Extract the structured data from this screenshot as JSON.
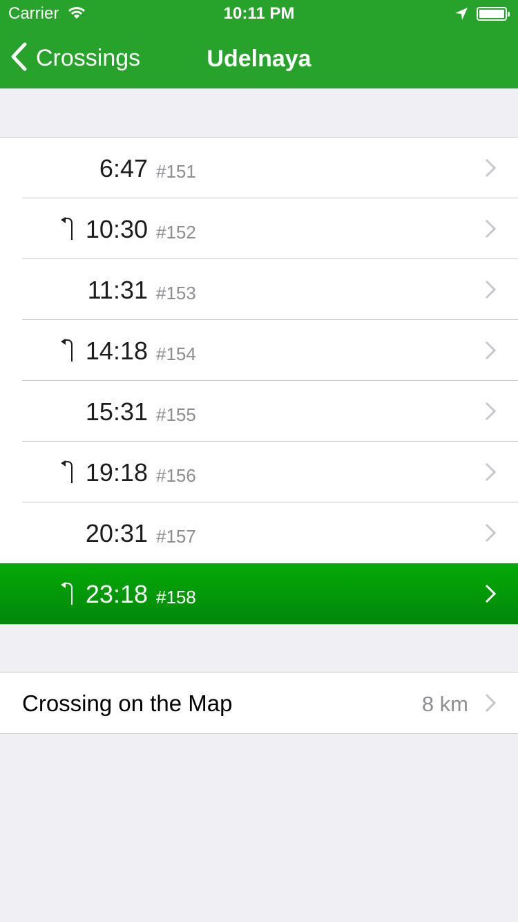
{
  "status_bar": {
    "carrier": "Carrier",
    "time": "10:11 PM"
  },
  "nav": {
    "back_label": "Crossings",
    "title": "Udelnaya",
    "bar_color": "#27a22a"
  },
  "trains": [
    {
      "time": "6:47",
      "number": "#151",
      "turn_icon": false,
      "selected": false
    },
    {
      "time": "10:30",
      "number": "#152",
      "turn_icon": true,
      "selected": false
    },
    {
      "time": "11:31",
      "number": "#153",
      "turn_icon": false,
      "selected": false
    },
    {
      "time": "14:18",
      "number": "#154",
      "turn_icon": true,
      "selected": false
    },
    {
      "time": "15:31",
      "number": "#155",
      "turn_icon": false,
      "selected": false
    },
    {
      "time": "19:18",
      "number": "#156",
      "turn_icon": true,
      "selected": false
    },
    {
      "time": "20:31",
      "number": "#157",
      "turn_icon": false,
      "selected": false
    },
    {
      "time": "23:18",
      "number": "#158",
      "turn_icon": true,
      "selected": true
    }
  ],
  "map_row": {
    "label": "Crossing on the Map",
    "distance": "8 km"
  },
  "icons": {
    "wifi": "wifi-icon",
    "location": "location-arrow-icon",
    "battery": "battery-icon",
    "back": "chevron-left-icon",
    "turn": "turn-back-arrow-icon",
    "disclosure": "chevron-right-icon"
  },
  "colors": {
    "selected_row": "#01990a",
    "secondary_text": "#8e8e93"
  }
}
